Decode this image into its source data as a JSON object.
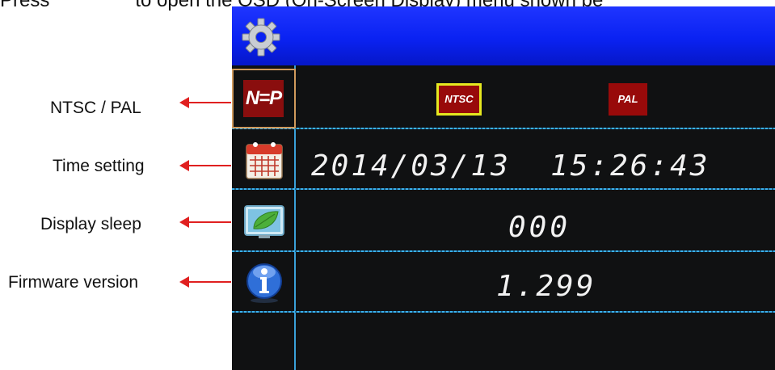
{
  "caption": {
    "before": "Press",
    "after": "to open the OSD (On-Screen Display) menu shown be"
  },
  "labels": {
    "ntsc_pal": "NTSC / PAL",
    "time_setting": "Time setting",
    "display_sleep": "Display sleep",
    "firmware_version": "Firmware version"
  },
  "osd": {
    "np_icon_text": "N=P",
    "options": {
      "ntsc": "NTSC",
      "pal": "PAL",
      "selected": "NTSC"
    },
    "datetime": "2014/03/13  15:26:43",
    "display_sleep_value": "000",
    "firmware_value": "1.299"
  },
  "colors": {
    "header_blue": "#0a22f2",
    "divider_cyan": "#3ab2ef",
    "option_red": "#980a0a",
    "selection_yellow": "#e5e820",
    "arrow_red": "#e02020"
  },
  "icons": [
    "gear-icon",
    "ntsc-pal-icon",
    "calendar-icon",
    "display-leaf-icon",
    "info-icon"
  ]
}
